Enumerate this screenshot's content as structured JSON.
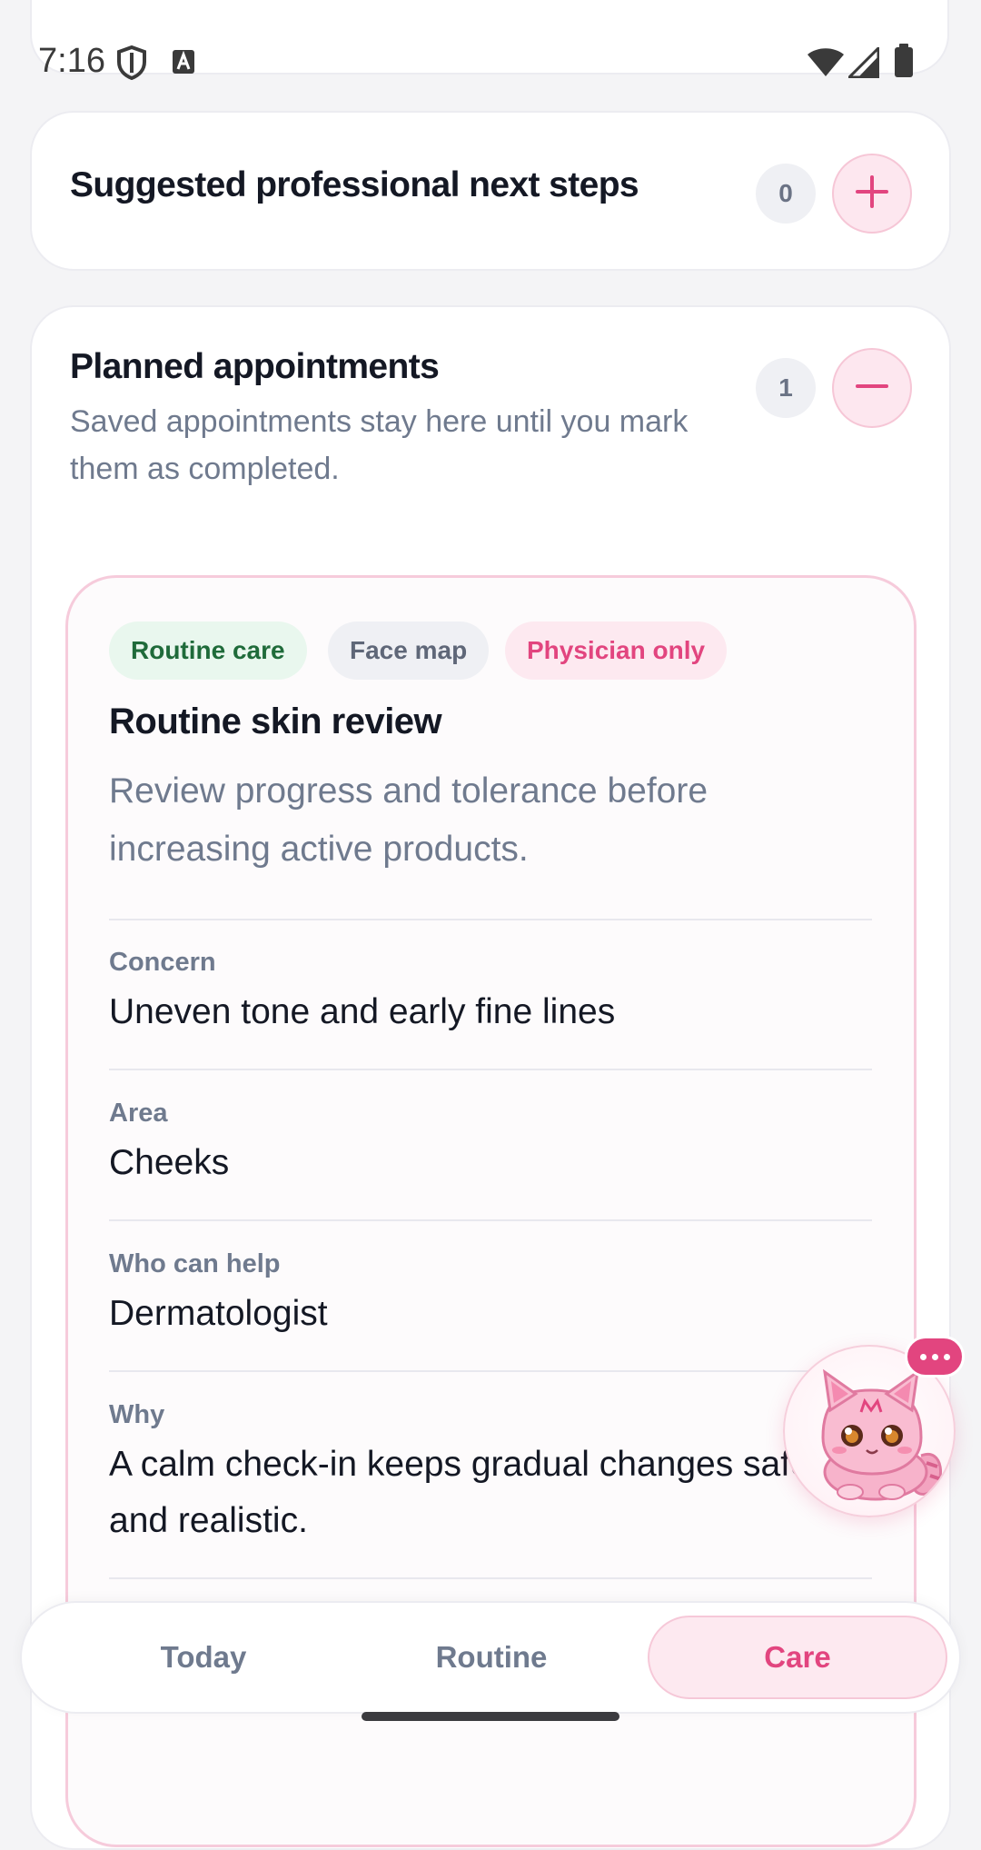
{
  "status_bar": {
    "time": "7:16"
  },
  "sections": {
    "suggested": {
      "title": "Suggested professional next steps",
      "count": "0",
      "toggle_icon": "plus-icon"
    },
    "planned": {
      "title": "Planned appointments",
      "subtitle": "Saved appointments stay here until you mark them as completed.",
      "count": "1",
      "toggle_icon": "minus-icon"
    }
  },
  "appointment": {
    "tags": {
      "care_type": "Routine care",
      "face_map": "Face map",
      "access": "Physician only"
    },
    "title": "Routine skin review",
    "description": "Review progress and tolerance before increasing active products.",
    "fields": {
      "concern": {
        "label": "Concern",
        "value": "Uneven tone and early fine lines"
      },
      "area": {
        "label": "Area",
        "value": "Cheeks"
      },
      "who": {
        "label": "Who can help",
        "value": "Dermatologist"
      },
      "why": {
        "label": "Why",
        "value": "A calm check-in keeps gradual changes safe and realistic."
      }
    }
  },
  "mascot": {
    "icon": "cat-mascot-icon",
    "bubble_icon": "chat-bubble-icon"
  },
  "bottom_nav": {
    "items": [
      {
        "label": "Today",
        "active": false
      },
      {
        "label": "Routine",
        "active": false
      },
      {
        "label": "Care",
        "active": true
      }
    ]
  },
  "colors": {
    "accent": "#e2457f",
    "accent_soft": "#fde9f0",
    "chip_green_bg": "#e9f7ee",
    "chip_green_text": "#1f6b3a",
    "chip_gray_bg": "#eff0f4",
    "muted_text": "#6f7a8e"
  }
}
